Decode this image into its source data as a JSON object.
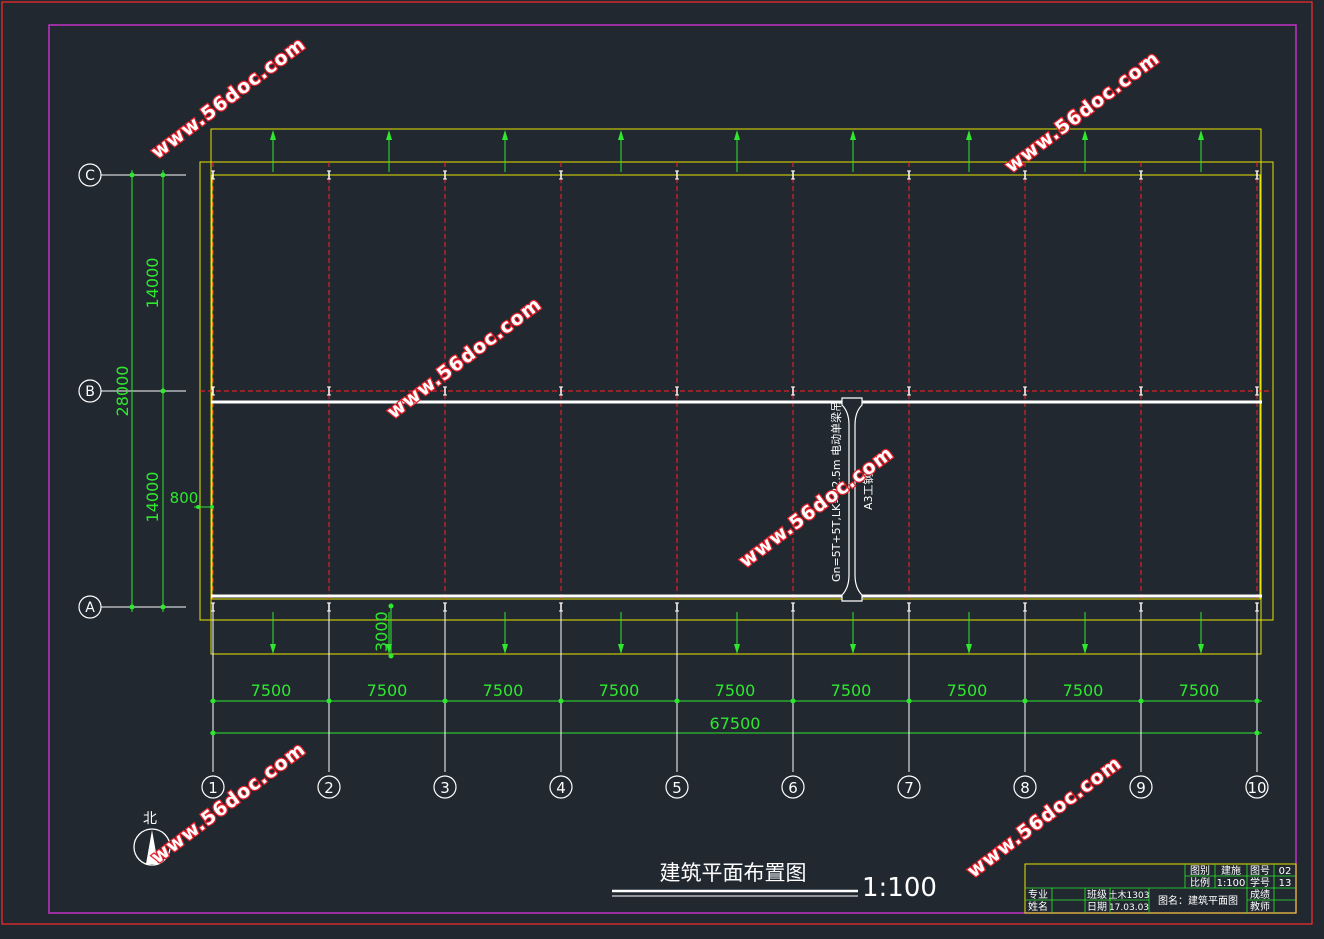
{
  "grid_columns": [
    "1",
    "2",
    "3",
    "4",
    "5",
    "6",
    "7",
    "8",
    "9",
    "10"
  ],
  "grid_rows": [
    "C",
    "B",
    "A"
  ],
  "dimensions": {
    "bay": "7500",
    "total_length": "67500",
    "span_upper": "14000",
    "span_lower": "14000",
    "total_width": "28000",
    "offset": "800",
    "canopy": "3000"
  },
  "crane": {
    "label": "Gn=5T+5T,LK=22.5m 电动单梁吊",
    "rail": "A3工钢"
  },
  "drawing_title": "建筑平面布置图",
  "drawing_scale": "1:100",
  "north_label": "北",
  "watermark": "www.56doc.com",
  "title_block": {
    "row1": [
      "图别",
      "建施",
      "图号",
      "02"
    ],
    "row2": [
      "比例",
      "1:100",
      "学号",
      "13"
    ],
    "major_label": "专业",
    "major_value": "",
    "class_label": "班级",
    "class_value": "土木1303",
    "name_label": "姓名",
    "name_value": "",
    "date_label": "日期",
    "date_value": "17.03.03",
    "drawing_name": "图名：建筑平面图",
    "grade_label": "成绩",
    "teacher_label": "教师"
  },
  "colors": {
    "background": "#212830",
    "frame": "#ff2a2a",
    "inner_frame": "#c032c8",
    "outline": "#e6e600",
    "dimension": "#2ee82e",
    "grid_line": "#ff2020",
    "rail": "#ffffff"
  }
}
